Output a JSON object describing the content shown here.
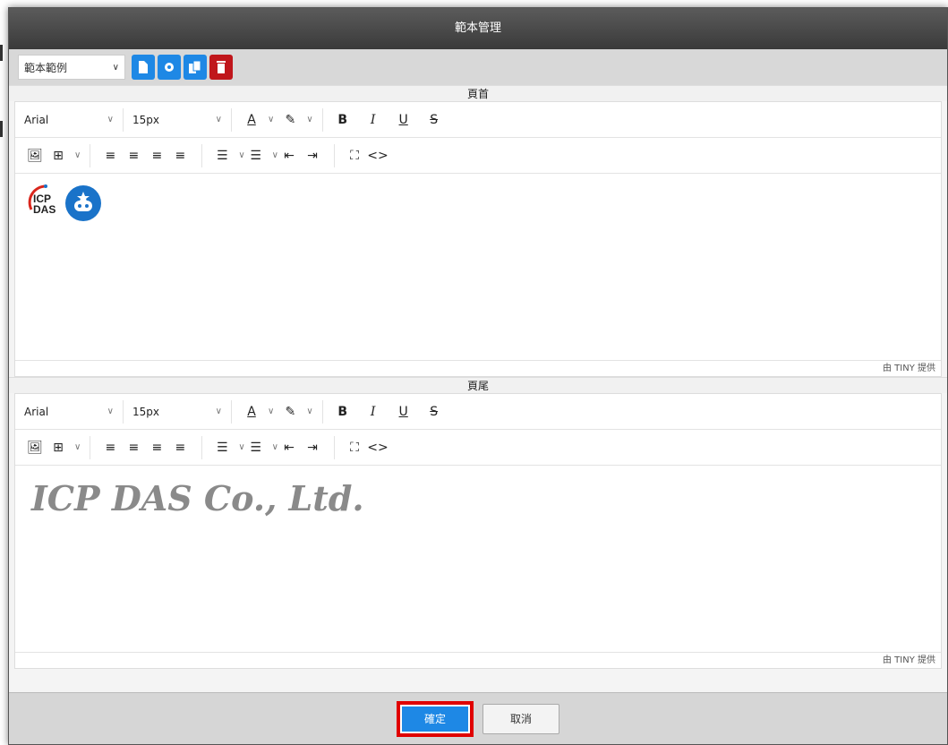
{
  "modal": {
    "title": "範本管理"
  },
  "template_bar": {
    "selected": "範本範例",
    "buttons": [
      "new-file-icon",
      "gear-icon",
      "copy-icon",
      "trash-icon"
    ]
  },
  "header_section": {
    "label": "頁首",
    "font": "Arial",
    "size": "15px",
    "powered": "由 TINY 提供",
    "logo_text": [
      "ICP",
      "DAS"
    ]
  },
  "footer_section": {
    "label": "頁尾",
    "font": "Arial",
    "size": "15px",
    "powered": "由 TINY 提供",
    "content": "ICP DAS Co., Ltd."
  },
  "format_buttons": {
    "font_color": "A",
    "bold": "B",
    "italic": "I",
    "underline": "U",
    "strike": "S"
  },
  "actions": {
    "ok": "確定",
    "cancel": "取消"
  },
  "colors": {
    "accent": "#1e88e5",
    "danger": "#c0161b",
    "highlight": "#e00000"
  }
}
